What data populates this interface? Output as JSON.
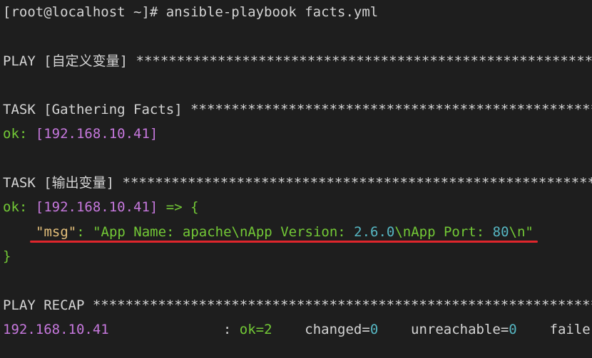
{
  "terminal": {
    "prompt": "[root@localhost ~]# ",
    "command": "ansible-playbook facts.yml",
    "play_header": {
      "label": "PLAY [自定义变量] ",
      "stars": "*************************************************************************************"
    },
    "task1_header": {
      "label": "TASK [Gathering Facts] ",
      "stars": "*************************************************************************************"
    },
    "task1_result": {
      "status": "ok: ",
      "host": "[192.168.10.41]"
    },
    "task2_header": {
      "label": "TASK [输出变量] ",
      "stars": "*************************************************************************************"
    },
    "task2_result": {
      "status": "ok: ",
      "host": "[192.168.10.41]",
      "arrow": " => {"
    },
    "msg_line": {
      "key": "\"msg\"",
      "colon": ": ",
      "value_part1": "\"App Name: apache\\nApp Version: ",
      "version": "2.6.0",
      "value_part2": "\\nApp Port: ",
      "port": "80",
      "value_part3": "\\n\""
    },
    "closing_brace": "}",
    "recap_header": {
      "label": "PLAY RECAP ",
      "stars": "*************************************************************************************"
    },
    "recap_row": {
      "host": "192.168.10.41",
      "spacing": "              : ",
      "ok_label": "ok=",
      "ok_value": "2",
      "changed_label": "    changed=",
      "changed_value": "0",
      "unreachable_label": "    unreachable=",
      "unreachable_value": "0",
      "failed_label": "    faile"
    }
  },
  "colors": {
    "background": "#1e1e1e",
    "text": "#d4d4d4",
    "ok_green": "#73c936",
    "host_purple": "#c678dd",
    "msg_yellow": "#e5c07b",
    "number_cyan": "#56b6c2",
    "annotation_red": "#e0262c"
  }
}
